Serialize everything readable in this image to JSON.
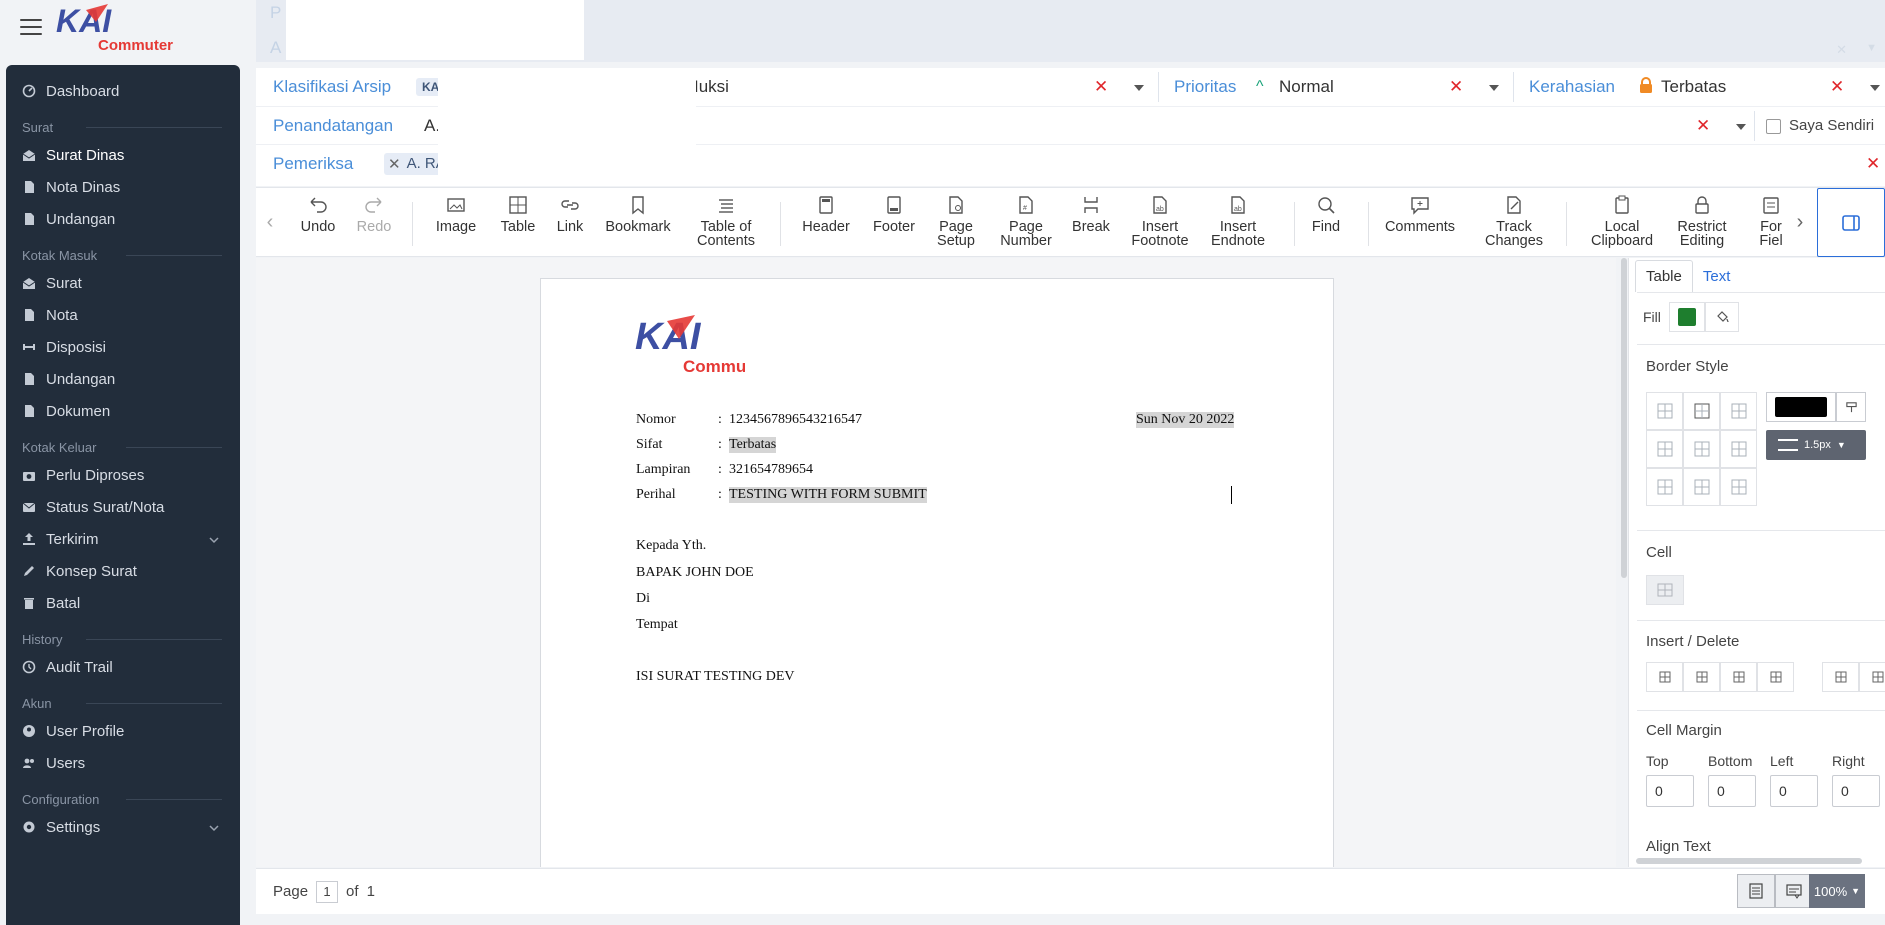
{
  "brand": {
    "logo_main": "KAI",
    "logo_sub": "Commuter",
    "brand_blue": "#3d4fa3",
    "brand_red": "#e53935"
  },
  "sidebar": {
    "items": [
      {
        "type": "item",
        "label": "Dashboard",
        "icon": "dashboard-icon"
      },
      {
        "type": "section",
        "label": "Surat"
      },
      {
        "type": "item",
        "label": "Surat Dinas",
        "icon": "envelope-open-icon",
        "active": true
      },
      {
        "type": "item",
        "label": "Nota Dinas",
        "icon": "file-icon"
      },
      {
        "type": "item",
        "label": "Undangan",
        "icon": "file-icon"
      },
      {
        "type": "section",
        "label": "Kotak Masuk"
      },
      {
        "type": "item",
        "label": "Surat",
        "icon": "envelope-open-icon"
      },
      {
        "type": "item",
        "label": "Nota",
        "icon": "file-icon"
      },
      {
        "type": "item",
        "label": "Disposisi",
        "icon": "dumbbell-icon"
      },
      {
        "type": "item",
        "label": "Undangan",
        "icon": "file-icon"
      },
      {
        "type": "item",
        "label": "Dokumen",
        "icon": "file-icon"
      },
      {
        "type": "section",
        "label": "Kotak Keluar"
      },
      {
        "type": "item",
        "label": "Perlu Diproses",
        "icon": "camera-icon"
      },
      {
        "type": "item",
        "label": "Status Surat/Nota",
        "icon": "mail-icon"
      },
      {
        "type": "item",
        "label": "Terkirim",
        "icon": "upload-icon",
        "chevron": true
      },
      {
        "type": "item",
        "label": "Konsep Surat",
        "icon": "pencil-icon"
      },
      {
        "type": "item",
        "label": "Batal",
        "icon": "trash-icon"
      },
      {
        "type": "section",
        "label": "History"
      },
      {
        "type": "item",
        "label": "Audit Trail",
        "icon": "history-icon"
      },
      {
        "type": "section",
        "label": "Akun"
      },
      {
        "type": "item",
        "label": "User Profile",
        "icon": "user-icon"
      },
      {
        "type": "item",
        "label": "Users",
        "icon": "users-icon"
      },
      {
        "type": "section",
        "label": "Configuration"
      },
      {
        "type": "item",
        "label": "Settings",
        "icon": "gear-icon",
        "chevron": true
      }
    ]
  },
  "header_ghost": {
    "line1": "P",
    "line2": "A"
  },
  "form": {
    "klasifikasi": {
      "label": "Klasifikasi Arsip",
      "tag": "KA",
      "value_fragment": "Iuksi"
    },
    "prioritas": {
      "label": "Prioritas",
      "value": "Normal"
    },
    "kerahasian": {
      "label": "Kerahasian",
      "value": "Terbatas"
    },
    "penandatangan": {
      "label": "Penandatangan",
      "value": "A.",
      "self_label": "Saya Sendiri"
    },
    "pemeriksa": {
      "label": "Pemeriksa",
      "tag": "A. RA"
    }
  },
  "toolbar": {
    "buttons": [
      {
        "label": "Undo",
        "icon": "undo-icon"
      },
      {
        "label": "Redo",
        "icon": "redo-icon",
        "disabled": true
      },
      {
        "label": "Image",
        "icon": "image-icon"
      },
      {
        "label": "Table",
        "icon": "table-icon"
      },
      {
        "label": "Link",
        "icon": "link-icon"
      },
      {
        "label": "Bookmark",
        "icon": "bookmark-icon"
      },
      {
        "label": "Table of\nContents",
        "icon": "toc-icon"
      },
      {
        "label": "Header",
        "icon": "header-icon"
      },
      {
        "label": "Footer",
        "icon": "footer-icon"
      },
      {
        "label": "Page\nSetup",
        "icon": "page-setup-icon"
      },
      {
        "label": "Page\nNumber",
        "icon": "page-number-icon"
      },
      {
        "label": "Break",
        "icon": "break-icon"
      },
      {
        "label": "Insert\nFootnote",
        "icon": "footnote-icon"
      },
      {
        "label": "Insert\nEndnote",
        "icon": "endnote-icon"
      },
      {
        "label": "Find",
        "icon": "find-icon"
      },
      {
        "label": "Comments",
        "icon": "comments-icon"
      },
      {
        "label": "Track\nChanges",
        "icon": "track-changes-icon"
      },
      {
        "label": "Local\nClipboard",
        "icon": "clipboard-icon"
      },
      {
        "label": "Restrict\nEditing",
        "icon": "lock-icon"
      },
      {
        "label": "For\nFiel",
        "icon": "form-fields-icon"
      }
    ]
  },
  "document": {
    "logo_main": "KAI",
    "logo_sub": "Commuter",
    "nomor_label": "Nomor",
    "nomor_value": "1234567896543216547",
    "date": "Sun Nov 20 2022",
    "sifat_label": "Sifat",
    "sifat_value": "Terbatas",
    "lampiran_label": "Lampiran",
    "lampiran_value": "321654789654",
    "perihal_label": "Perihal",
    "perihal_value": "TESTING WITH FORM SUBMIT",
    "colon": ":",
    "kepada": "Kepada Yth.",
    "recipient": "BAPAK JOHN DOE",
    "di": "Di",
    "tempat": "Tempat",
    "body": "ISI SURAT TESTING DEV"
  },
  "right_panel": {
    "tab_table": "Table",
    "tab_text": "Text",
    "fill_label": "Fill",
    "fill_color": "#1e7e2e",
    "border_style_label": "Border Style",
    "border_color": "#000000",
    "border_width": "1.5px",
    "cell_label": "Cell",
    "insert_delete_label": "Insert / Delete",
    "cell_margin_label": "Cell Margin",
    "margin_top_label": "Top",
    "margin_bottom_label": "Bottom",
    "margin_left_label": "Left",
    "margin_right_label": "Right",
    "margin_top": "0",
    "margin_bottom": "0",
    "margin_left": "0",
    "margin_right": "0",
    "align_text_label": "Align Text"
  },
  "statusbar": {
    "page_label": "Page",
    "page_current": "1",
    "of_label": "of",
    "page_total": "1",
    "zoom": "100%"
  }
}
